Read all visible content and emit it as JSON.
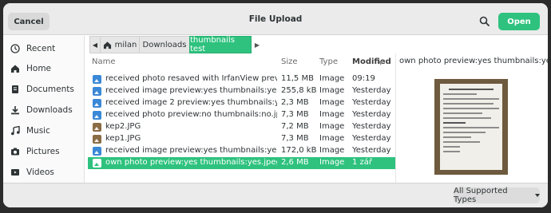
{
  "header": {
    "cancel_label": "Cancel",
    "title": "File Upload",
    "open_label": "Open"
  },
  "sidebar": {
    "items": [
      {
        "label": "Recent",
        "icon": "clock-icon"
      },
      {
        "label": "Home",
        "icon": "home-icon"
      },
      {
        "label": "Documents",
        "icon": "document-icon"
      },
      {
        "label": "Downloads",
        "icon": "download-icon"
      },
      {
        "label": "Music",
        "icon": "music-icon"
      },
      {
        "label": "Pictures",
        "icon": "camera-icon"
      },
      {
        "label": "Videos",
        "icon": "video-icon"
      }
    ]
  },
  "pathbar": {
    "crumbs": [
      {
        "label": "milan",
        "icon": "home-icon"
      },
      {
        "label": "Downloads"
      },
      {
        "label": "thumbnails test"
      }
    ]
  },
  "columns": {
    "name": "Name",
    "size": "Size",
    "type": "Type",
    "modified": "Modified"
  },
  "files": [
    {
      "name": "received photo resaved with IrfanView preview:n...",
      "size": "11,5 MB",
      "type": "Image",
      "modified": "09:19"
    },
    {
      "name": "received image preview:yes thumbnails:yes.jpg",
      "size": "255,8 kB",
      "type": "Image",
      "modified": "Yesterday"
    },
    {
      "name": "received image 2 preview:yes thumbnails:yes.png",
      "size": "2,3 MB",
      "type": "Image",
      "modified": "Yesterday"
    },
    {
      "name": "received photo preview:no thumbnails:no.jpeg",
      "size": "7,3 MB",
      "type": "Image",
      "modified": "Yesterday"
    },
    {
      "name": "kep2.JPG",
      "size": "7,2 MB",
      "type": "Image",
      "modified": "Yesterday"
    },
    {
      "name": "kep1.JPG",
      "size": "7,3 MB",
      "type": "Image",
      "modified": "Yesterday"
    },
    {
      "name": "received image preview:yes thumbnails:yes.png",
      "size": "172,0 kB",
      "type": "Image",
      "modified": "Yesterday"
    },
    {
      "name": "own photo preview:yes thumbnails:yes.jpeg",
      "size": "2,6 MB",
      "type": "Image",
      "modified": "1 zář"
    }
  ],
  "preview": {
    "filename": "own photo preview:yes thumbnails:yes.jpeg"
  },
  "footer": {
    "filter_label": "All Supported Types"
  },
  "colors": {
    "accent": "#2ec27e",
    "header_bg": "#ebebeb",
    "file_icon": "#3a88d6"
  }
}
